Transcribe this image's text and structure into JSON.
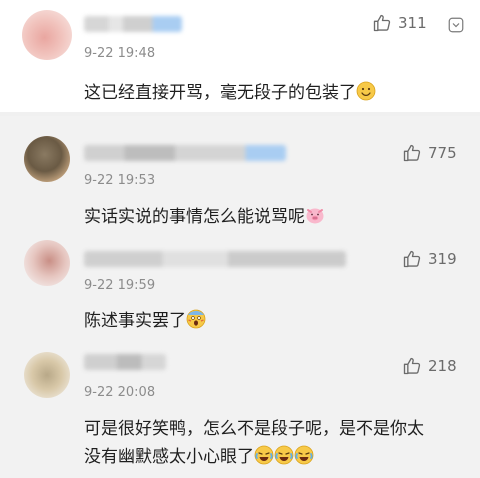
{
  "top": {
    "time": "9-22 19:48",
    "likes": "311",
    "text": "这已经直接开骂，毫无段子的包装了"
  },
  "replies": [
    {
      "time": "9-22 19:53",
      "likes": "775",
      "text": "实话实说的事情怎么能说骂呢"
    },
    {
      "time": "9-22 19:59",
      "likes": "319",
      "text": "陈述事实罢了"
    },
    {
      "time": "9-22 20:08",
      "likes": "218",
      "text_line1": "可是很好笑鸭，怎么不是段子呢，是不是你太",
      "text_line2": "没有幽默感太小心眼了"
    }
  ],
  "icons": {
    "like": "thumbs-up-icon",
    "more": "more-options-icon",
    "emoji_smile": "smile-emoji",
    "emoji_pig": "pig-emoji",
    "emoji_scream": "scream-emoji",
    "emoji_laugh": "laugh-cry-emoji"
  },
  "colors": {
    "reply_bg": "#f2f2f2",
    "meta_gray": "#8c8c8c",
    "accent_blue": "#a9cdf2"
  }
}
